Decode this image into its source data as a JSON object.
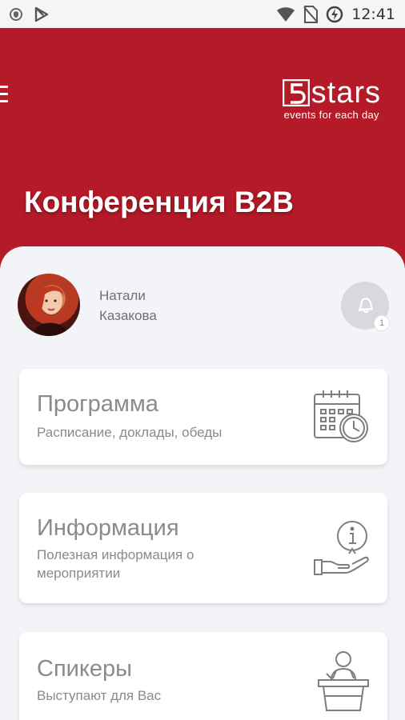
{
  "status_bar": {
    "time": "12:41"
  },
  "header": {
    "logo_word": "stars",
    "logo_tagline": "events for each day",
    "title": "Конференция B2B"
  },
  "profile": {
    "first_name": "Натали",
    "last_name": "Казакова",
    "notification_count": "1"
  },
  "cards": [
    {
      "title": "Программа",
      "subtitle": "Расписание, доклады, обеды",
      "icon": "calendar-clock-icon"
    },
    {
      "title": "Информация",
      "subtitle": "Полезная информация о мероприятии",
      "icon": "info-hand-icon"
    },
    {
      "title": "Спикеры",
      "subtitle": "Выступают для Вас",
      "icon": "speaker-podium-icon"
    }
  ],
  "colors": {
    "brand_red": "#b51a28",
    "background": "#f3f4f8",
    "muted_text": "#8a8a8f"
  }
}
